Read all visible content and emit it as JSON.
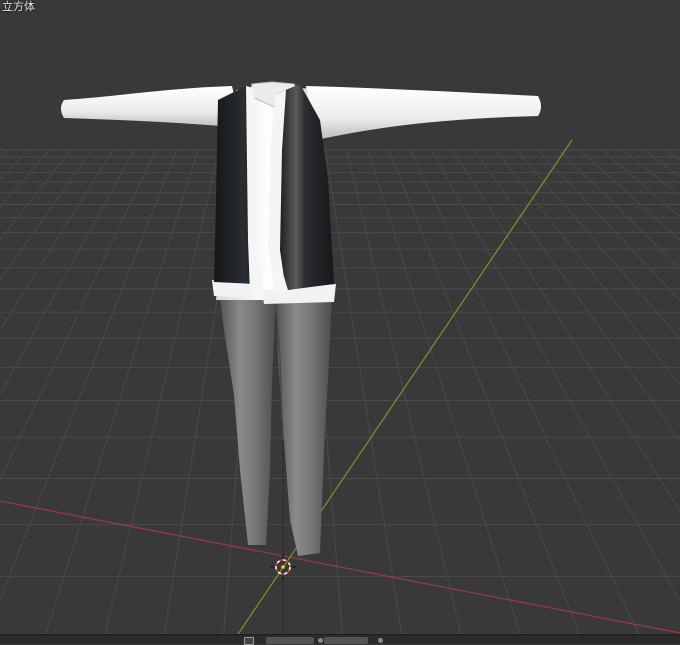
{
  "viewport": {
    "object_name": "立方体",
    "background_color": "#393939",
    "x_axis_color": "#9b3a44",
    "y_axis_color": "#6f9a2c",
    "grid_color": "#4a4a4a"
  },
  "scene": {
    "model": "clothed-mannequin-t-pose",
    "shirt_color": "#f2f2f2",
    "vest_color": "#1e2124",
    "pants_color": "#7a7a7a",
    "cursor_icon": "3d-cursor-icon"
  },
  "bottom_bar": {
    "icons": [
      "editor-type-icon",
      "view-icon",
      "overlay-icon"
    ]
  }
}
